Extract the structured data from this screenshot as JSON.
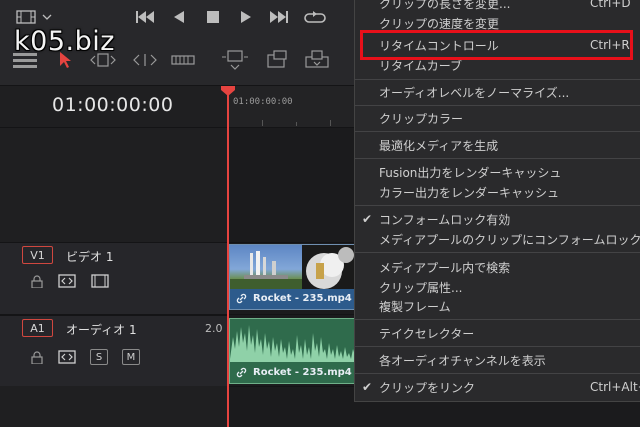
{
  "watermark": "k05.biz",
  "timeline": {
    "timecode": "01:00:00:00",
    "ruler_timecode": "01:00:00:00"
  },
  "tracks": {
    "video": {
      "badge": "V1",
      "name": "ビデオ 1"
    },
    "audio": {
      "badge": "A1",
      "name": "オーディオ 1",
      "channels": "2.0",
      "solo": "S",
      "mute": "M"
    }
  },
  "clips": {
    "video_clip": "Rocket - 235.mp4",
    "audio_clip": "Rocket - 235.mp4"
  },
  "menu": {
    "items": [
      {
        "label": "クリップの長さを変更...",
        "shortcut": "Ctrl+D"
      },
      {
        "label": "クリップの速度を変更",
        "shortcut": ""
      },
      {
        "label": "リタイムコントロール",
        "shortcut": "Ctrl+R"
      },
      {
        "label": "リタイムカーブ",
        "shortcut": ""
      },
      {
        "label": "オーディオレベルをノーマライズ...",
        "shortcut": ""
      },
      {
        "label": "クリップカラー",
        "shortcut": ""
      },
      {
        "label": "最適化メディアを生成",
        "shortcut": ""
      },
      {
        "label": "Fusion出力をレンダーキャッシュ",
        "shortcut": ""
      },
      {
        "label": "カラー出力をレンダーキャッシュ",
        "shortcut": ""
      },
      {
        "label": "コンフォームロック有効",
        "shortcut": "",
        "checked": "✔"
      },
      {
        "label": "メディアプールのクリップにコンフォームロック",
        "shortcut": ""
      },
      {
        "label": "メディアプール内で検索",
        "shortcut": ""
      },
      {
        "label": "クリップ属性...",
        "shortcut": ""
      },
      {
        "label": "複製フレーム",
        "shortcut": ""
      },
      {
        "label": "テイクセレクター",
        "shortcut": ""
      },
      {
        "label": "各オーディオチャンネルを表示",
        "shortcut": ""
      },
      {
        "label": "クリップをリンク",
        "shortcut": "Ctrl+Alt+",
        "checked": "✔"
      }
    ]
  },
  "colors": {
    "accent_red": "#e8101a",
    "playhead": "#e64440",
    "video_clip": "#2d5b8c",
    "audio_clip": "#2f6b4c"
  }
}
